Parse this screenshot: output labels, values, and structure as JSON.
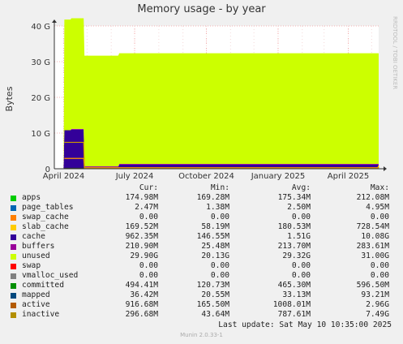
{
  "chart_data": {
    "type": "area",
    "title": "Memory usage - by year",
    "ylabel": "Bytes",
    "side_label": "RRDTOOL / TOBI OETIKER",
    "ylim": [
      0,
      40
    ],
    "y_unit": "G",
    "y_ticks": [
      {
        "value": 0,
        "label": "0"
      },
      {
        "value": 10,
        "label": "10 G"
      },
      {
        "value": 20,
        "label": "20 G"
      },
      {
        "value": 30,
        "label": "30 G"
      },
      {
        "value": 40,
        "label": "40 G"
      }
    ],
    "x_ticks": [
      {
        "date": "2024-04-01",
        "label": "April 2024"
      },
      {
        "date": "2024-07-01",
        "label": "July 2024"
      },
      {
        "date": "2024-10-01",
        "label": "October 2024"
      },
      {
        "date": "2025-01-01",
        "label": "January 2025"
      },
      {
        "date": "2025-04-01",
        "label": "April 2025"
      }
    ],
    "x_range": [
      "2024-03-20",
      "2025-05-10"
    ],
    "stack_series": [
      {
        "name": "apps",
        "color": "#00cc00",
        "start_date": "2024-04-10",
        "values_gb": [
          {
            "date": "2024-04-10",
            "value": 0.17
          },
          {
            "date": "2025-05-10",
            "value": 0.17
          }
        ]
      },
      {
        "name": "cache",
        "color": "#330099",
        "start_date": "2024-04-01",
        "values_gb": [
          {
            "date": "2024-04-01",
            "value": 10.8
          },
          {
            "date": "2024-04-26",
            "value": 10.8
          },
          {
            "date": "2024-04-27",
            "value": 0.3
          },
          {
            "date": "2024-06-10",
            "value": 0.4
          },
          {
            "date": "2024-06-11",
            "value": 1.0
          },
          {
            "date": "2025-05-10",
            "value": 0.96
          }
        ]
      },
      {
        "name": "buffers",
        "color": "#990099",
        "start_date": "2024-04-10",
        "values_gb": [
          {
            "date": "2024-04-10",
            "value": 0.2
          },
          {
            "date": "2025-05-10",
            "value": 0.21
          }
        ]
      },
      {
        "name": "unused",
        "color": "#ccff00",
        "start_date": "2024-04-01",
        "values_gb": [
          {
            "date": "2024-04-01",
            "value": 31.0
          },
          {
            "date": "2025-05-10",
            "value": 31.0
          }
        ]
      }
    ],
    "lines": [
      {
        "name": "committed",
        "color": "#336600",
        "values_gb": [
          {
            "date": "2024-04-01",
            "value": 0.12
          },
          {
            "date": "2025-05-10",
            "value": 0.49
          }
        ]
      },
      {
        "name": "mapped",
        "color": "#330066",
        "values_gb": [
          {
            "date": "2024-04-01",
            "value": 0.02
          },
          {
            "date": "2025-05-10",
            "value": 0.04
          }
        ]
      },
      {
        "name": "active",
        "color": "#ff9900",
        "values_gb": [
          {
            "date": "2024-04-01",
            "value": 2.9
          },
          {
            "date": "2024-04-26",
            "value": 2.9
          },
          {
            "date": "2024-04-27",
            "value": 0.3
          },
          {
            "date": "2025-05-10",
            "value": 0.92
          }
        ]
      },
      {
        "name": "inactive",
        "color": "#cc9900",
        "values_gb": [
          {
            "date": "2024-04-01",
            "value": 7.4
          },
          {
            "date": "2024-04-26",
            "value": 7.4
          },
          {
            "date": "2024-04-27",
            "value": 0.1
          },
          {
            "date": "2025-05-10",
            "value": 0.3
          }
        ]
      }
    ],
    "legend_headers": [
      "Cur:",
      "Min:",
      "Avg:",
      "Max:"
    ],
    "legend": [
      {
        "name": "apps",
        "color": "#00cc00",
        "cur": "174.98M",
        "min": "169.28M",
        "avg": "175.34M",
        "max": "212.08M"
      },
      {
        "name": "page_tables",
        "color": "#0066b3",
        "cur": "2.47M",
        "min": "1.38M",
        "avg": "2.50M",
        "max": "4.95M"
      },
      {
        "name": "swap_cache",
        "color": "#ff8000",
        "cur": "0.00",
        "min": "0.00",
        "avg": "0.00",
        "max": "0.00"
      },
      {
        "name": "slab_cache",
        "color": "#ffcc00",
        "cur": "169.52M",
        "min": "58.19M",
        "avg": "180.53M",
        "max": "728.54M"
      },
      {
        "name": "cache",
        "color": "#330099",
        "cur": "962.35M",
        "min": "146.55M",
        "avg": "1.51G",
        "max": "10.08G"
      },
      {
        "name": "buffers",
        "color": "#990099",
        "cur": "210.90M",
        "min": "25.48M",
        "avg": "213.70M",
        "max": "283.61M"
      },
      {
        "name": "unused",
        "color": "#ccff00",
        "cur": "29.90G",
        "min": "20.13G",
        "avg": "29.32G",
        "max": "31.00G"
      },
      {
        "name": "swap",
        "color": "#ff0000",
        "cur": "0.00",
        "min": "0.00",
        "avg": "0.00",
        "max": "0.00"
      },
      {
        "name": "vmalloc_used",
        "color": "#808080",
        "cur": "0.00",
        "min": "0.00",
        "avg": "0.00",
        "max": "0.00"
      },
      {
        "name": "committed",
        "color": "#008f00",
        "cur": "494.41M",
        "min": "120.73M",
        "avg": "465.30M",
        "max": "596.50M"
      },
      {
        "name": "mapped",
        "color": "#00487d",
        "cur": "36.42M",
        "min": "20.55M",
        "avg": "33.13M",
        "max": "93.21M"
      },
      {
        "name": "active",
        "color": "#b35a00",
        "cur": "916.68M",
        "min": "165.50M",
        "avg": "1008.01M",
        "max": "2.96G"
      },
      {
        "name": "inactive",
        "color": "#b38f00",
        "cur": "296.68M",
        "min": "43.64M",
        "avg": "787.61M",
        "max": "7.49G"
      }
    ],
    "last_update": "Last update: Sat May 10 10:35:00 2025",
    "footer": "Munin 2.0.33-1",
    "grid": true
  }
}
